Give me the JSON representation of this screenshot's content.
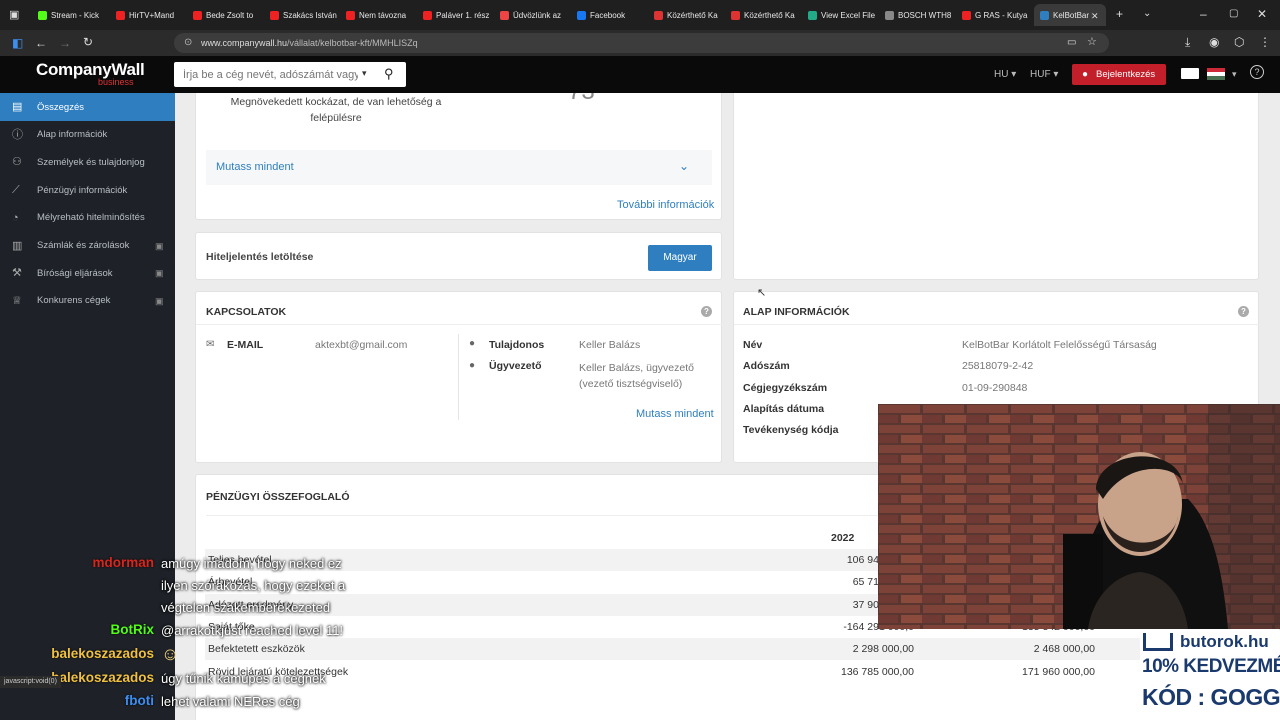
{
  "browser": {
    "tabs": [
      {
        "label": "Stream - Kick",
        "color": "#53fc18"
      },
      {
        "label": "HirTV+Mand",
        "color": "#e22"
      },
      {
        "label": "Bede Zsolt to",
        "color": "#e22"
      },
      {
        "label": "Szakács István",
        "color": "#e22"
      },
      {
        "label": "Nem távozna",
        "color": "#e22"
      },
      {
        "label": "Paláver 1. rész",
        "color": "#e22"
      },
      {
        "label": "Üdvözlünk az",
        "color": "#e44"
      },
      {
        "label": "Facebook",
        "color": "#1877f2"
      },
      {
        "label": "Közérthető Ka",
        "color": "#d33"
      },
      {
        "label": "Közérthető Ka",
        "color": "#d33"
      },
      {
        "label": "View Excel File",
        "color": "#2a8"
      },
      {
        "label": "BOSCH WTH8",
        "color": "#888"
      },
      {
        "label": "G RAS - Kutya",
        "color": "#e22"
      },
      {
        "label": "KelBotBar | ",
        "color": "#2f7fc0"
      }
    ],
    "url_host": "www.companywall.hu",
    "url_path": "/vállalat/kelbotbar-kft/MMHLISZq",
    "status_text": "javascript:void(0)"
  },
  "site": {
    "logo": "CompanyWall",
    "logo_sub": "business",
    "search_placeholder": "Írja be a cég nevét, adószámát vagy",
    "lang": "HU",
    "currency": "HUF",
    "login_label": "Bejelentkezés"
  },
  "sidebar": {
    "items": [
      {
        "label": "Összegzés",
        "icon": "document-icon"
      },
      {
        "label": "Alap információk",
        "icon": "info-icon"
      },
      {
        "label": "Személyek és tulajdonjog",
        "icon": "people-icon"
      },
      {
        "label": "Pénzügyi információk",
        "icon": "chart-icon"
      },
      {
        "label": "Mélyreható hitelminősítés",
        "icon": "gauge-icon"
      },
      {
        "label": "Számlák és zárolások",
        "icon": "bank-icon"
      },
      {
        "label": "Bírósági eljárások",
        "icon": "gavel-icon"
      },
      {
        "label": "Konkurens cégek",
        "icon": "trophy-icon"
      }
    ]
  },
  "risk": {
    "text": "Megnövekedett kockázat, de van lehetőség a felépülésre",
    "score": "73",
    "show_all": "Mutass mindent",
    "more_info": "További információk"
  },
  "download": {
    "title": "Hiteljelentés letöltése",
    "button": "Magyar"
  },
  "contacts": {
    "title": "KAPCSOLATOK",
    "email_label": "E-MAIL",
    "email": "aktexbt@gmail.com",
    "owner_label": "Tulajdonos",
    "owner": "Keller Balázs",
    "ceo_label": "Ügyvezető",
    "ceo": "Keller Balázs, ügyvezető (vezető tisztségviselő)",
    "show_all": "Mutass mindent"
  },
  "basic": {
    "title": "ALAP INFORMÁCIÓK",
    "rows": [
      {
        "label": "Név",
        "value": "KelBotBar Korlátolt Felelősségű Társaság"
      },
      {
        "label": "Adószám",
        "value": "25818079-2-42"
      },
      {
        "label": "Cégjegyzékszám",
        "value": "01-09-290848"
      },
      {
        "label": "Alapítás dátuma",
        "value": ""
      },
      {
        "label": "Tevékenység kódja",
        "value": ""
      }
    ]
  },
  "finance": {
    "title": "PÉNZÜGYI ÖSSZEFOGLALÓ",
    "year": "2022",
    "rows": [
      {
        "label": "Teljes bevétel",
        "v1": "106 946 000,0",
        "v2": ""
      },
      {
        "label": "Árbevétel",
        "v1": "65 710 000,0",
        "v2": ""
      },
      {
        "label": "Adózott eredmény",
        "v1": "37 906 000,0",
        "v2": ""
      },
      {
        "label": "Saját tőke",
        "v1": "-164 291 000,0",
        "v2": "-135 342 000,00"
      },
      {
        "label": "Befektetett eszközök",
        "v1": "2 298 000,00",
        "v2": "2 468 000,00"
      },
      {
        "label": "Rövid lejáratú kötelezettségek",
        "v1": "136 785 000,00",
        "v2": "171 960 000,00"
      }
    ]
  },
  "chat": [
    {
      "name": "mdorman",
      "color": "#d9261c",
      "msg": "amúgy imádom, hogy neked ez"
    },
    {
      "name": "",
      "color": "#fff",
      "msg": "ilyen szórakozás, hogy ezeket a"
    },
    {
      "name": "",
      "color": "#fff",
      "msg": "végtelen szakemberekezeted"
    },
    {
      "name": "BotRix",
      "color": "#53fc18",
      "msg": "@arrakotkjust reached level 11!"
    },
    {
      "name": "balekoszazados",
      "color": "#f0c040",
      "msg": ""
    },
    {
      "name": "balekoszazados",
      "color": "#f0c040",
      "msg": "úgy tűnik kamupés a cégnek"
    },
    {
      "name": "fboti",
      "color": "#3d8ef0",
      "msg": "lehet valami NERes cég"
    }
  ],
  "ad": {
    "brand": "butorok.hu",
    "line1": "10% KEDVEZMÉNY",
    "line2": "KÓD : GOGGER"
  }
}
